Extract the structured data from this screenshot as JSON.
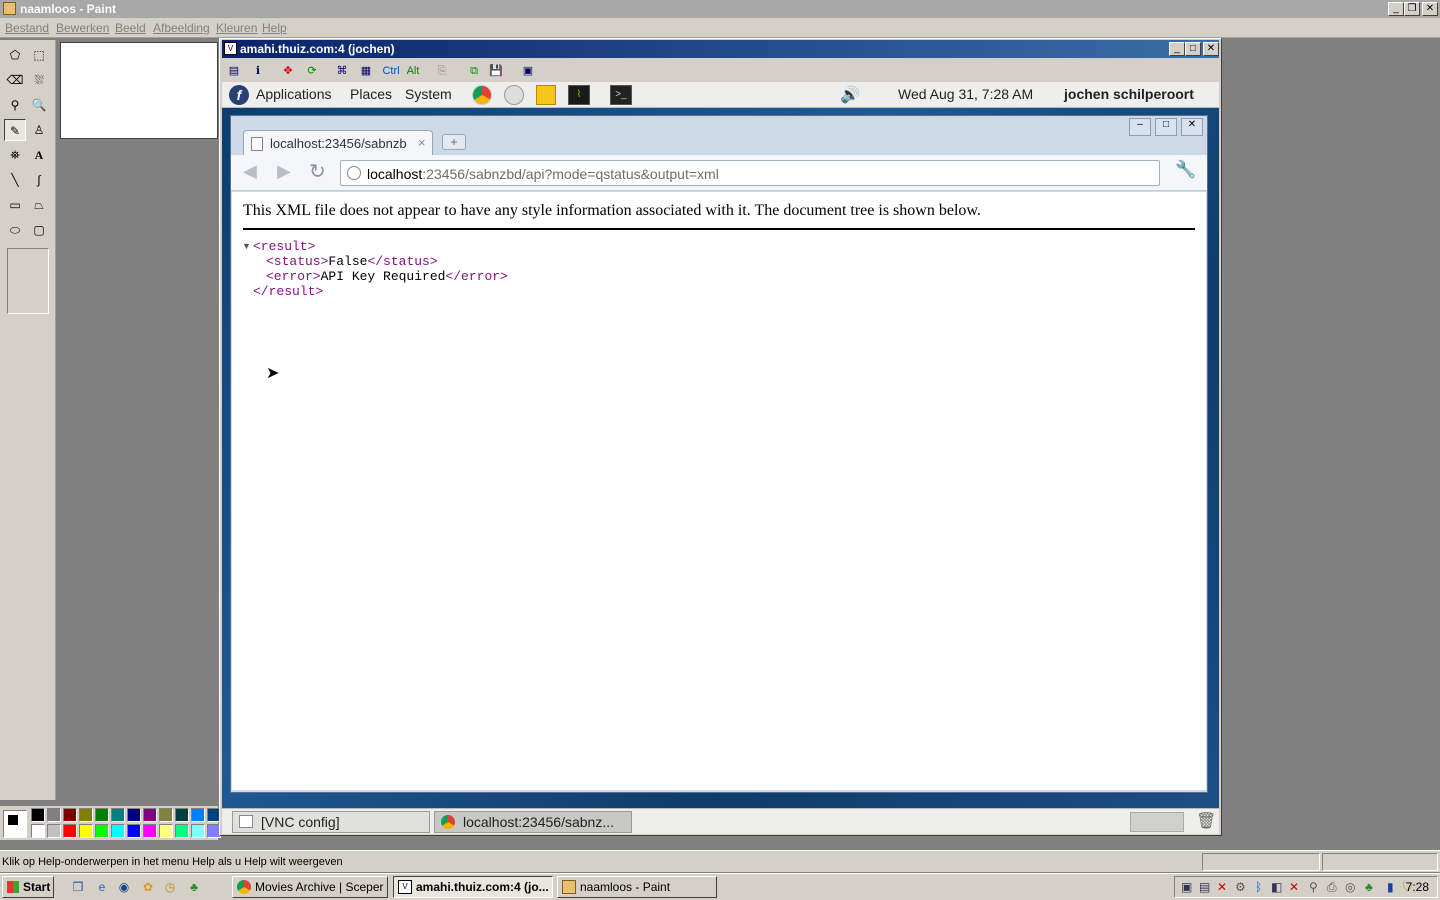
{
  "paint": {
    "title": "naamloos - Paint",
    "menu": [
      "Bestand",
      "Bewerken",
      "Beeld",
      "Afbeelding",
      "Kleuren",
      "Help"
    ],
    "status": "Klik op Help-onderwerpen in het menu Help als u Help wilt weergeven",
    "palette": [
      "#000000",
      "#808080",
      "#800000",
      "#808000",
      "#008000",
      "#008080",
      "#000080",
      "#800080",
      "#808040",
      "#004040",
      "#0080ff",
      "#004080",
      "#ffffff",
      "#c0c0c0",
      "#ff0000",
      "#ffff00",
      "#00ff00",
      "#00ffff",
      "#0000ff",
      "#ff00ff",
      "#ffff80",
      "#00ff80",
      "#80ffff",
      "#8080ff"
    ]
  },
  "vnc": {
    "title": "amahi.thuiz.com:4 (jochen)",
    "toolbar_text": {
      "ctrl": "Ctrl",
      "alt": "Alt"
    }
  },
  "gnome": {
    "menu": {
      "applications": "Applications",
      "places": "Places",
      "system": "System"
    },
    "datetime": "Wed Aug 31,  7:28 AM",
    "user": "jochen schilperoort",
    "bottom": {
      "vnc_config": "[VNC config]",
      "browser": "localhost:23456/sabnz..."
    }
  },
  "chrome": {
    "tab_title": "localhost:23456/sabnzb",
    "url_host": "localhost",
    "url_rest": ":23456/sabnzbd/api?mode=qstatus&output=xml",
    "xml_info": "This XML file does not appear to have any style information associated with it. The document tree is shown below.",
    "xml": {
      "result_open": "<result>",
      "status_open": "<status>",
      "status_value": "False",
      "status_close": "</status>",
      "error_open": "<error>",
      "error_value": "API Key Required",
      "error_close": "</error>",
      "result_close": "</result>"
    }
  },
  "taskbar": {
    "start": "Start",
    "items": [
      "Movies Archive | Sceper ...",
      "amahi.thuiz.com:4 (jo...",
      "naamloos - Paint"
    ],
    "clock": "7:28"
  }
}
